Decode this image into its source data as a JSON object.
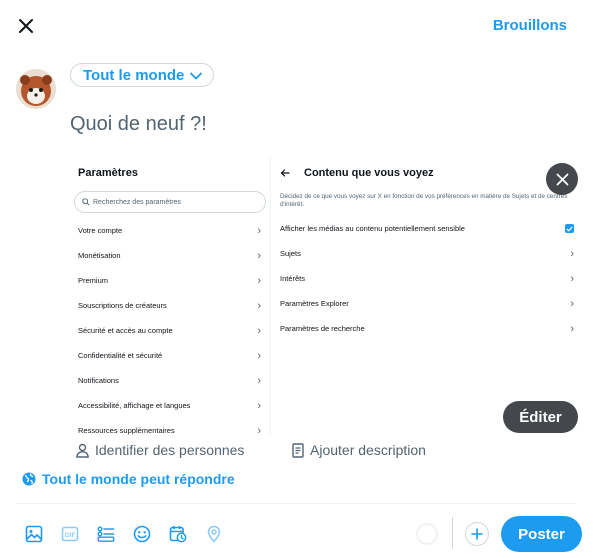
{
  "header": {
    "drafts_label": "Brouillons"
  },
  "composer": {
    "audience_label": "Tout le monde",
    "placeholder": "Quoi de neuf ?!"
  },
  "attached_screenshot": {
    "left": {
      "title": "Paramètres",
      "search_placeholder": "Recherchez des paramètres",
      "items": [
        "Votre compte",
        "Monétisation",
        "Premium",
        "Souscriptions de créateurs",
        "Sécurité et accès au compte",
        "Confidentialité et sécurité",
        "Notifications",
        "Accessibilité, affichage et langues",
        "Ressources supplémentaires"
      ]
    },
    "right": {
      "title": "Contenu que vous voyez",
      "description": "Décidez de ce que vous voyez sur X en fonction de vos préférences en matière de Sujets et de centres d'intérêt.",
      "checkbox_label": "Afficher les médias au contenu potentiellement sensible",
      "items": [
        "Sujets",
        "Intérêts",
        "Paramètres Explorer",
        "Paramètres de recherche"
      ]
    }
  },
  "media_actions": {
    "edit_label": "Éditer",
    "tag_label": "Identifier des personnes",
    "description_label": "Ajouter description"
  },
  "reply_setting": "Tout le monde peut répondre",
  "toolbar": {
    "icons": [
      "image-icon",
      "gif-icon",
      "poll-icon",
      "emoji-icon",
      "schedule-icon",
      "location-icon"
    ],
    "post_label": "Poster"
  },
  "colors": {
    "accent": "#1d9bf0",
    "text": "#0f1419",
    "muted": "#536471"
  }
}
